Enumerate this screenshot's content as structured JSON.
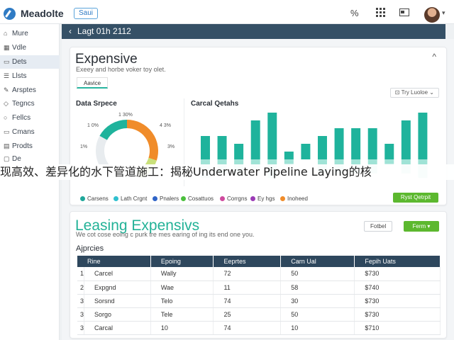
{
  "app": {
    "title": "Meadolte",
    "badge": "Saui",
    "icons": [
      "percent-icon",
      "grid-icon",
      "card-icon"
    ],
    "percent_glyph": "%"
  },
  "sidebar": {
    "items": [
      {
        "label": "Mure",
        "icon": "home-icon",
        "glyph": "⌂"
      },
      {
        "label": "Vdle",
        "icon": "chart-icon",
        "glyph": "▦"
      },
      {
        "label": "Dets",
        "icon": "car-icon",
        "glyph": "▭",
        "active": true
      },
      {
        "label": "Llsts",
        "icon": "list-icon",
        "glyph": "☰"
      },
      {
        "label": "Arsptes",
        "icon": "pin-icon",
        "glyph": "✎"
      },
      {
        "label": "Tegncs",
        "icon": "tag-icon",
        "glyph": "◇"
      },
      {
        "label": "Fellcs",
        "icon": "bulb-icon",
        "glyph": "○"
      },
      {
        "label": "Cmans",
        "icon": "folder-icon",
        "glyph": "▭"
      },
      {
        "label": "Prodts",
        "icon": "box-icon",
        "glyph": "▤"
      },
      {
        "label": "De",
        "icon": "doc-icon",
        "glyph": "▢"
      }
    ]
  },
  "header": {
    "back_glyph": "‹",
    "title": "Lagt 01h 2112"
  },
  "expenses_card": {
    "title": "Expensive",
    "subtitle": "Exeey and horbe voker toy olet.",
    "tab": "Aavice",
    "range": "⊡ Try Luoloe ⌄",
    "collapse_glyph": "^",
    "donut_title": "Data Srpece",
    "donut_labels": {
      "top": "1 30%",
      "left": "1 0%",
      "right_top": "4 3%",
      "left_bottom": "1%",
      "right_bottom": "3%"
    },
    "bar_title": "Carcal Qetahs",
    "legend": [
      {
        "label": "Carsens",
        "color": "#1fa79a"
      },
      {
        "label": "Lath Crgnt",
        "color": "#30c0cf"
      },
      {
        "label": "Pnalers",
        "color": "#2f64c7"
      },
      {
        "label": "Cosattuos",
        "color": "#4bbf3d"
      },
      {
        "label": "Corrgns",
        "color": "#cf4a9e"
      },
      {
        "label": "Ey hgs",
        "color": "#9b3bb6"
      },
      {
        "label": "Inoheed",
        "color": "#f08c2a"
      }
    ],
    "action_button": "Ryst Qetrpit"
  },
  "chart_data": {
    "type": "bar",
    "series": [
      {
        "name": "",
        "values": [
          3,
          3,
          2,
          5,
          8,
          1,
          2,
          3,
          4,
          4,
          4,
          2,
          5,
          7
        ]
      }
    ],
    "secondary_values": [
      4,
      3,
      3,
      2,
      4,
      1,
      0,
      3,
      3,
      3,
      3,
      1,
      3,
      4
    ],
    "donut": {
      "segments": [
        {
          "value": 30,
          "color": "#f08c2a"
        },
        {
          "value": 13,
          "color": "#c9e07a"
        },
        {
          "value": 40,
          "color": "#e8ecef"
        },
        {
          "value": 17,
          "color": "#1fb39c"
        }
      ]
    }
  },
  "overlay": {
    "text": "现高效、差异化的水下管道施工：揭秘Underwater Pipeline Laying的核"
  },
  "leasing_card": {
    "title": "Leasing Expensivs",
    "subtitle": "We cot cose eoing c purk tre mes earing of ing its end one you.",
    "btn_outline": "Fotbel",
    "btn_primary": "Ferm ▾",
    "section": "Ajprcies",
    "columns": [
      "Rine",
      "Epoing",
      "Eeprtes",
      "Carn Ual",
      "Fepih Uats"
    ],
    "rows": [
      {
        "n": "1",
        "c1": "Carcel",
        "c2": "Wally",
        "c3": "72",
        "c4": "50",
        "c5": "$730"
      },
      {
        "n": "2",
        "c1": "Expgnd",
        "c2": "Wae",
        "c3": "11",
        "c4": "58",
        "c5": "$740"
      },
      {
        "n": "3",
        "c1": "Sorsnd",
        "c2": "Telo",
        "c3": "74",
        "c4": "30",
        "c5": "$730"
      },
      {
        "n": "3",
        "c1": "Sorgo",
        "c2": "Tele",
        "c3": "25",
        "c4": "50",
        "c5": "$730"
      },
      {
        "n": "3",
        "c1": "Carcal",
        "c2": "10",
        "c3": "74",
        "c4": "10",
        "c5": "$710"
      }
    ]
  }
}
